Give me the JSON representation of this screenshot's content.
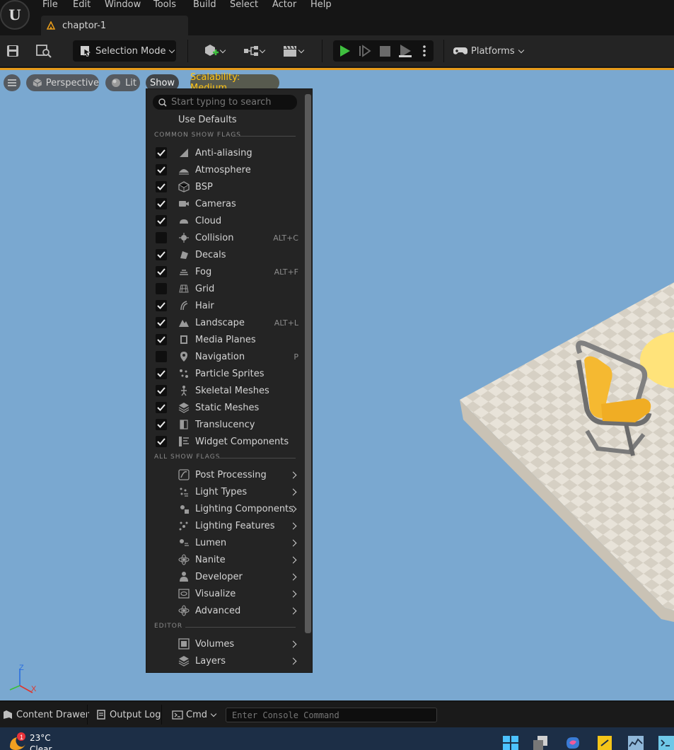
{
  "menubar": {
    "items": [
      {
        "label": "File"
      },
      {
        "label": "Edit"
      },
      {
        "label": "Window"
      },
      {
        "label": "Tools"
      },
      {
        "label": "Build"
      },
      {
        "label": "Select"
      },
      {
        "label": "Actor"
      },
      {
        "label": "Help"
      }
    ]
  },
  "level_tab": {
    "label": "chaptor-1"
  },
  "toolbar": {
    "selection_mode": "Selection Mode",
    "platforms": "Platforms"
  },
  "viewport": {
    "perspective": "Perspective",
    "lit": "Lit",
    "show": "Show",
    "scalability": "Scalability: Medium",
    "axis_z": "Z",
    "axis_x": "X"
  },
  "show_menu": {
    "search_placeholder": "Start typing to search",
    "use_defaults": "Use Defaults",
    "common_header": "COMMON SHOW FLAGS",
    "all_header": "ALL SHOW FLAGS",
    "editor_header": "EDITOR",
    "common_flags": [
      {
        "label": "Anti-aliasing",
        "checked": true,
        "shortcut": "",
        "icon": "antialias-icon"
      },
      {
        "label": "Atmosphere",
        "checked": true,
        "shortcut": "",
        "icon": "atmosphere-icon"
      },
      {
        "label": "BSP",
        "checked": true,
        "shortcut": "",
        "icon": "bsp-icon"
      },
      {
        "label": "Cameras",
        "checked": true,
        "shortcut": "",
        "icon": "camera-icon"
      },
      {
        "label": "Cloud",
        "checked": true,
        "shortcut": "",
        "icon": "cloud-icon"
      },
      {
        "label": "Collision",
        "checked": false,
        "shortcut": "ALT+C",
        "icon": "collision-icon"
      },
      {
        "label": "Decals",
        "checked": true,
        "shortcut": "",
        "icon": "decal-icon"
      },
      {
        "label": "Fog",
        "checked": true,
        "shortcut": "ALT+F",
        "icon": "fog-icon"
      },
      {
        "label": "Grid",
        "checked": false,
        "shortcut": "",
        "icon": "grid-icon"
      },
      {
        "label": "Hair",
        "checked": true,
        "shortcut": "",
        "icon": "hair-icon"
      },
      {
        "label": "Landscape",
        "checked": true,
        "shortcut": "ALT+L",
        "icon": "landscape-icon"
      },
      {
        "label": "Media Planes",
        "checked": true,
        "shortcut": "",
        "icon": "media-plane-icon"
      },
      {
        "label": "Navigation",
        "checked": false,
        "shortcut": "P",
        "icon": "navigation-icon"
      },
      {
        "label": "Particle Sprites",
        "checked": true,
        "shortcut": "",
        "icon": "particle-icon"
      },
      {
        "label": "Skeletal Meshes",
        "checked": true,
        "shortcut": "",
        "icon": "skeletal-mesh-icon"
      },
      {
        "label": "Static Meshes",
        "checked": true,
        "shortcut": "",
        "icon": "static-mesh-icon"
      },
      {
        "label": "Translucency",
        "checked": true,
        "shortcut": "",
        "icon": "translucency-icon"
      },
      {
        "label": "Widget Components",
        "checked": true,
        "shortcut": "",
        "icon": "widget-icon"
      }
    ],
    "all_flags": [
      {
        "label": "Post Processing",
        "icon": "post-process-icon"
      },
      {
        "label": "Light Types",
        "icon": "light-types-icon"
      },
      {
        "label": "Lighting Components",
        "icon": "lighting-components-icon"
      },
      {
        "label": "Lighting Features",
        "icon": "lighting-features-icon"
      },
      {
        "label": "Lumen",
        "icon": "lumen-icon"
      },
      {
        "label": "Nanite",
        "icon": "nanite-icon"
      },
      {
        "label": "Developer",
        "icon": "developer-icon"
      },
      {
        "label": "Visualize",
        "icon": "visualize-icon"
      },
      {
        "label": "Advanced",
        "icon": "advanced-icon"
      }
    ],
    "editor_flags": [
      {
        "label": "Volumes",
        "icon": "volumes-icon"
      },
      {
        "label": "Layers",
        "icon": "layers-icon"
      }
    ]
  },
  "statusbar": {
    "content_drawer": "Content Drawer",
    "output_log": "Output Log",
    "cmd": "Cmd",
    "console_placeholder": "Enter Console Command"
  },
  "taskbar": {
    "weather_temp": "23°C",
    "weather_cond": "Clear",
    "notification_count": "1"
  },
  "colors": {
    "accent_orange": "#e59a1a",
    "play_green": "#3fbf3f",
    "scalability_yellow": "#ffc414",
    "viewport_sky": "#7aa8d0"
  }
}
